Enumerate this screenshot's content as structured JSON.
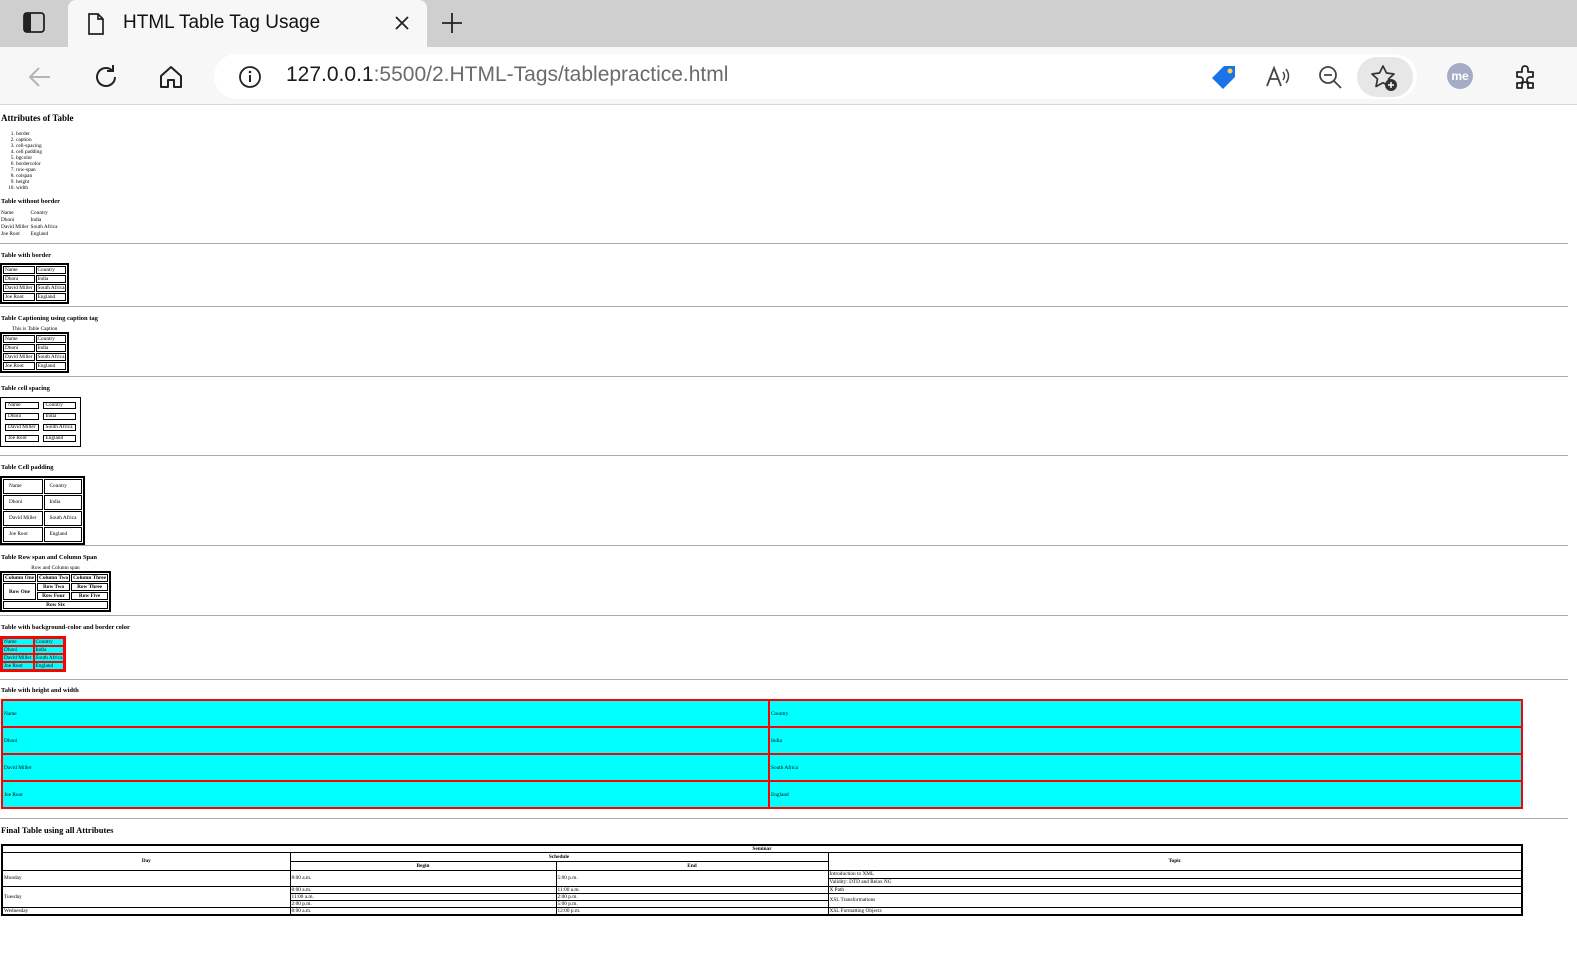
{
  "browser": {
    "tab_title": "HTML Table Tag Usage",
    "url_host": "127.0.0.1",
    "url_path": ":5500/2.HTML-Tags/tablepractice.html",
    "profile_initials": "me"
  },
  "page": {
    "heading": "Attributes of Table",
    "attributes": [
      "border",
      "caption",
      "cell-spacing",
      "cell padding",
      "bgcolor",
      "bordercolor",
      "row-span",
      "colspan",
      "height",
      "width"
    ],
    "players_header": [
      "Name",
      "Country"
    ],
    "players": [
      [
        "Dhoni",
        "India"
      ],
      [
        "David Miller",
        "South Africa"
      ],
      [
        "Joe Root",
        "England"
      ]
    ],
    "sections": {
      "no_border": "Table without border",
      "border": "Table with border",
      "caption": "Table Captioning using caption tag",
      "spacing": "Table cell spacing",
      "padding": "Table Cell padding",
      "span": "Table Row span and Column Span",
      "bgcolor": "Table with background-color and border color",
      "size": "Table with height and width"
    },
    "caption_text": "This is Table Caption",
    "span_table": {
      "caption": "Row and Column span",
      "headers": [
        "Column One",
        "Column Two",
        "Column Three"
      ],
      "row_one": "Row One",
      "row_two": "Row Two",
      "row_three": "Row Three",
      "row_four": "Row Four",
      "row_five": "Row Five",
      "row_six": "Row Six"
    },
    "final": {
      "heading": "Final Table using all Attributes",
      "seminar": "Seminar",
      "day": "Day",
      "schedule": "Schedule",
      "topic": "Topic",
      "begin": "Begin",
      "end": "End",
      "monday": "Monday",
      "mon_begin": "8:00 a.m.",
      "mon_end": "5:00 p.m.",
      "mon_topic1": "Introduction to XML",
      "mon_topic2": "Validity: DTD and Relax NG",
      "tuesday": "Tuesday",
      "tue_begin1": "8:00 a.m.",
      "tue_end1": "11:00 a.m.",
      "tue_begin2": "11:00 a.m.",
      "tue_end2": "2:00 p.m.",
      "tue_begin3": "2:00 p.m.",
      "tue_end3": "5:00 p.m.",
      "tue_topic1": "X Path",
      "tue_topic2": "XSL Transformations",
      "wednesday": "Wednesday",
      "wed_begin": "8:00 a.m.",
      "wed_end": "12:00 p.m.",
      "wed_topic": "XSL Formatting Objects"
    }
  },
  "colors": {
    "cyan_bg": "#00ffff",
    "red_border": "#ff0000",
    "tag_icon": "#1a73e8"
  }
}
